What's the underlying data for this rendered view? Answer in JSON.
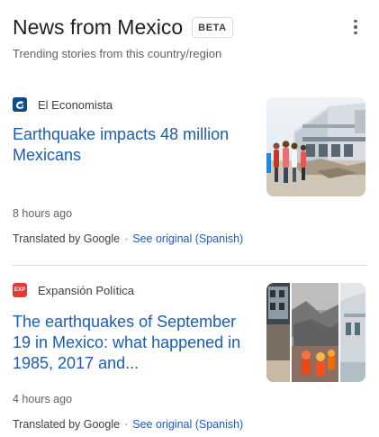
{
  "header": {
    "title": "News from Mexico",
    "badge": "BETA",
    "subtitle": "Trending stories from this country/region",
    "menu_icon": "more-vert-icon"
  },
  "articles": [
    {
      "source": "El Economista",
      "source_logo_icon": "el-economista-logo",
      "source_logo_color": "#0b4f8a",
      "headline": "Earthquake impacts 48 million Mexicans",
      "time": "8 hours ago",
      "translated_by": "Translated by Google",
      "separator": "·",
      "see_original": "See original (Spanish)",
      "thumbnail": "earthquake-building-photo"
    },
    {
      "source": "Expansión Política",
      "source_logo_icon": "expansion-logo",
      "source_logo_color": "#e53935",
      "source_logo_text": "EXP",
      "headline": "The earthquakes of September 19 in Mexico: what happened in 1985, 2017 and...",
      "time": "4 hours ago",
      "translated_by": "Translated by Google",
      "separator": "·",
      "see_original": "See original (Spanish)",
      "thumbnail": "earthquake-collage-photo"
    }
  ],
  "colors": {
    "link": "#1a5dbb",
    "text": "#202124",
    "secondary": "#5f6368",
    "divider": "#dadce0"
  }
}
